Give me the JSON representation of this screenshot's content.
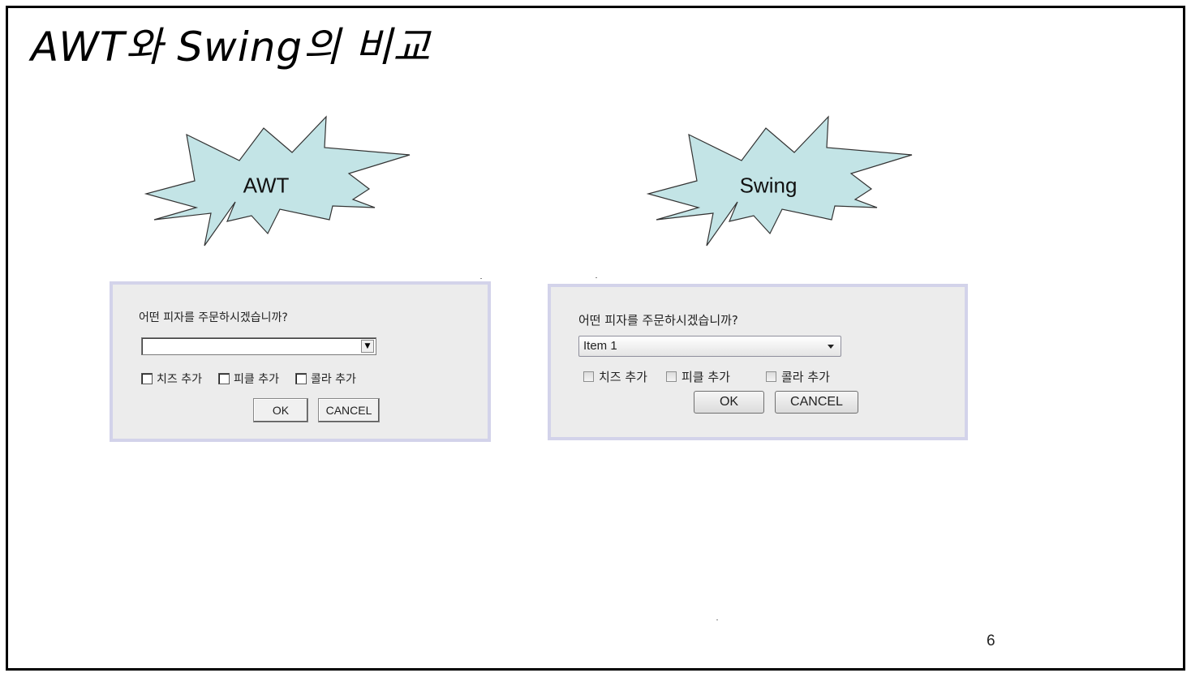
{
  "slide": {
    "title": "AWT와 Swing의 비교",
    "page_number": "6"
  },
  "colors": {
    "burst_fill": "#c3e4e6",
    "panel_border": "#d3d3ea",
    "panel_bg": "#ececec"
  },
  "awt": {
    "label": "AWT",
    "question": "어떤 피자를 주문하시겠습니까?",
    "choice_value": "",
    "checkboxes": [
      {
        "label": "치즈 추가",
        "checked": false
      },
      {
        "label": "피클 추가",
        "checked": false
      },
      {
        "label": "콜라 추가",
        "checked": false
      }
    ],
    "ok_label": "OK",
    "cancel_label": "CANCEL"
  },
  "swing": {
    "label": "Swing",
    "question": "어떤 피자를 주문하시겠습니까?",
    "combo_value": "Item 1",
    "checkboxes": [
      {
        "label": "치즈 추가",
        "checked": false
      },
      {
        "label": "피클 추가",
        "checked": false
      },
      {
        "label": "콜라 추가",
        "checked": false
      }
    ],
    "ok_label": "OK",
    "cancel_label": "CANCEL"
  }
}
